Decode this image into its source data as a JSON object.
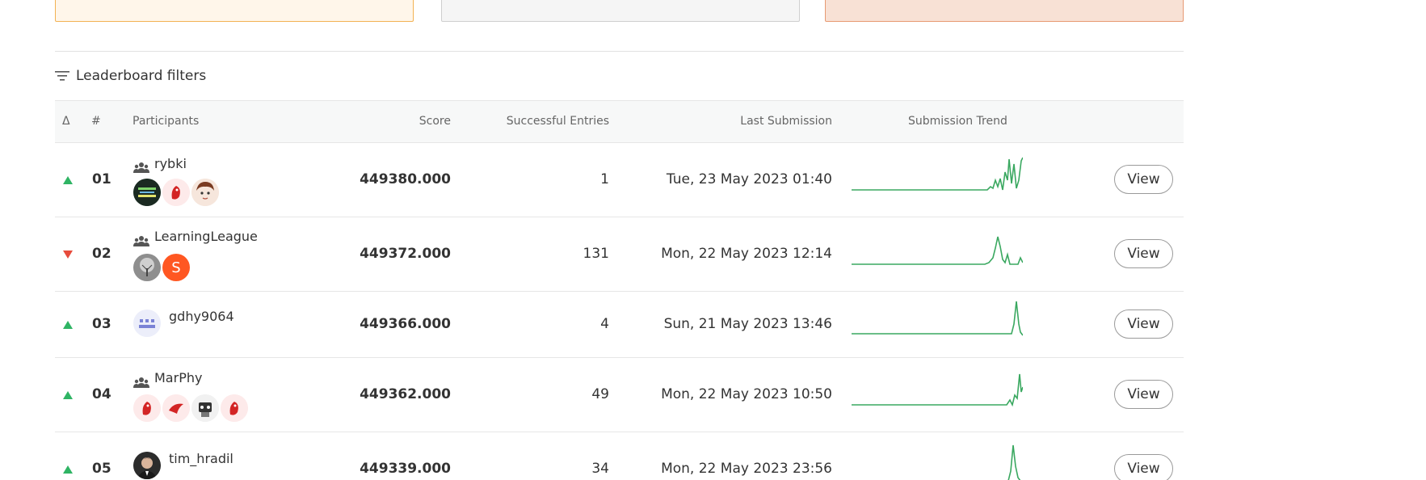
{
  "filters": {
    "label": "Leaderboard filters",
    "icon": "filter-icon"
  },
  "table": {
    "headers": {
      "delta": "Δ",
      "rank": "#",
      "participants": "Participants",
      "score": "Score",
      "entries": "Successful Entries",
      "last_submission": "Last Submission",
      "trend": "Submission Trend"
    },
    "rows": [
      {
        "trend_direction": "up",
        "rank": "01",
        "name": "rybki",
        "is_team": true,
        "score": "449380.000",
        "entries": "1",
        "last_submission": "Tue, 23 May 2023 01:40",
        "view_label": "View",
        "members": [
          "avatar-badge",
          "avatar-bird",
          "avatar-anime"
        ]
      },
      {
        "trend_direction": "down",
        "rank": "02",
        "name": "LearningLeague",
        "is_team": true,
        "score": "449372.000",
        "entries": "131",
        "last_submission": "Mon, 22 May 2023 12:14",
        "view_label": "View",
        "members": [
          "avatar-tree",
          "avatar-letter"
        ],
        "member_letter": "S"
      },
      {
        "trend_direction": "up",
        "rank": "03",
        "name": "gdhy9064",
        "is_team": false,
        "score": "449366.000",
        "entries": "4",
        "last_submission": "Sun, 21 May 2023 13:46",
        "view_label": "View",
        "members": [
          "avatar-default"
        ]
      },
      {
        "trend_direction": "up",
        "rank": "04",
        "name": "MarPhy",
        "is_team": true,
        "score": "449362.000",
        "entries": "49",
        "last_submission": "Mon, 22 May 2023 10:50",
        "view_label": "View",
        "members": [
          "avatar-bird",
          "avatar-bird-2",
          "avatar-robot",
          "avatar-bird"
        ]
      },
      {
        "trend_direction": "up",
        "rank": "05",
        "name": "tim_hradil",
        "is_team": false,
        "score": "449339.000",
        "entries": "34",
        "last_submission": "Mon, 22 May 2023 23:56",
        "view_label": "View",
        "members": [
          "avatar-photo"
        ]
      }
    ]
  },
  "colors": {
    "up": "#2fb464",
    "down": "#e74c3c",
    "sparkline": "#3aa860",
    "card_1_bg": "#fff6ea",
    "card_2_bg": "#f5f5f5",
    "card_3_bg": "#f8e1d5",
    "letter_avatar": "#ff5722"
  }
}
